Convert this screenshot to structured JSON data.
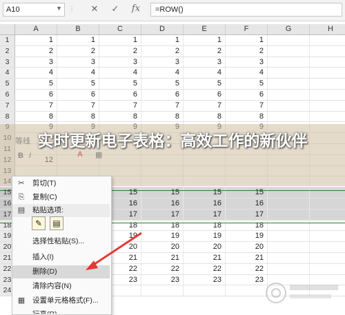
{
  "formula_bar": {
    "name_box": "A10",
    "cancel_icon": "✕",
    "confirm_icon": "✓",
    "fx_label": "fx",
    "formula": "=ROW()"
  },
  "columns": [
    "A",
    "B",
    "C",
    "D",
    "E",
    "F",
    "G",
    "H"
  ],
  "rows": [
    {
      "num": "1",
      "vals": [
        "1",
        "1",
        "1",
        "1",
        "1",
        "1"
      ]
    },
    {
      "num": "2",
      "vals": [
        "2",
        "2",
        "2",
        "2",
        "2",
        "2"
      ]
    },
    {
      "num": "3",
      "vals": [
        "3",
        "3",
        "3",
        "3",
        "3",
        "3"
      ]
    },
    {
      "num": "4",
      "vals": [
        "4",
        "4",
        "4",
        "4",
        "4",
        "4"
      ]
    },
    {
      "num": "5",
      "vals": [
        "5",
        "5",
        "5",
        "5",
        "5",
        "5"
      ]
    },
    {
      "num": "6",
      "vals": [
        "6",
        "6",
        "6",
        "6",
        "6",
        "6"
      ]
    },
    {
      "num": "7",
      "vals": [
        "7",
        "7",
        "7",
        "7",
        "7",
        "7"
      ]
    },
    {
      "num": "8",
      "vals": [
        "8",
        "8",
        "8",
        "8",
        "8",
        "8"
      ]
    },
    {
      "num": "9",
      "vals": [
        "9",
        "9",
        "9",
        "9",
        "9",
        "9"
      ]
    },
    {
      "num": "10",
      "vals": [
        "",
        "",
        "",
        "",
        "",
        ""
      ]
    },
    {
      "num": "11",
      "vals": [
        "",
        "",
        "",
        "",
        "",
        ""
      ]
    },
    {
      "num": "12",
      "vals": [
        "12",
        "",
        "",
        "",
        "",
        ""
      ]
    },
    {
      "num": "13",
      "vals": [
        "",
        "",
        "",
        "",
        "",
        ""
      ]
    },
    {
      "num": "14",
      "vals": [
        "",
        "",
        "",
        "",
        "",
        ""
      ]
    },
    {
      "num": "15",
      "vals": [
        "",
        "",
        "15",
        "15",
        "15",
        "15"
      ]
    },
    {
      "num": "16",
      "vals": [
        "",
        "",
        "16",
        "16",
        "16",
        "16"
      ]
    },
    {
      "num": "17",
      "vals": [
        "",
        "",
        "17",
        "17",
        "17",
        "17"
      ]
    },
    {
      "num": "18",
      "vals": [
        "",
        "",
        "18",
        "18",
        "18",
        "18"
      ]
    },
    {
      "num": "19",
      "vals": [
        "",
        "",
        "19",
        "19",
        "19",
        "19"
      ]
    },
    {
      "num": "20",
      "vals": [
        "",
        "",
        "20",
        "20",
        "20",
        "20"
      ]
    },
    {
      "num": "21",
      "vals": [
        "",
        "",
        "21",
        "21",
        "21",
        "21"
      ]
    },
    {
      "num": "22",
      "vals": [
        "",
        "",
        "22",
        "22",
        "22",
        "22"
      ]
    },
    {
      "num": "23",
      "vals": [
        "",
        "",
        "23",
        "23",
        "23",
        "23"
      ]
    },
    {
      "num": "24",
      "vals": [
        "",
        "",
        "",
        "",
        "",
        ""
      ]
    }
  ],
  "selected_rows": [
    "15",
    "16",
    "17"
  ],
  "title": "实时更新电子表格：高效工作的新伙伴",
  "mini_toolbar": {
    "font": "等线",
    "bold": "B",
    "italic": "I"
  },
  "context_menu": {
    "items": [
      {
        "label": "剪切(T)",
        "icon": "scissors-icon",
        "glyph": "✂"
      },
      {
        "label": "复制(C)",
        "icon": "copy-icon",
        "glyph": "⎘"
      },
      {
        "label": "粘贴选项:",
        "icon": "paste-icon",
        "glyph": "📋"
      },
      {
        "label": "选择性粘贴(S)...",
        "icon": "",
        "glyph": ""
      },
      {
        "label": "插入(I)",
        "icon": "",
        "glyph": ""
      },
      {
        "label": "删除(D)",
        "icon": "",
        "glyph": ""
      },
      {
        "label": "清除内容(N)",
        "icon": "",
        "glyph": ""
      },
      {
        "label": "设置单元格格式(F)...",
        "icon": "format-cells-icon",
        "glyph": "▦"
      },
      {
        "label": "行高(R)...",
        "icon": "",
        "glyph": ""
      }
    ]
  },
  "colors": {
    "selection_border": "#2e7d32",
    "arrow": "#e53935",
    "highlight": "#d9d9d9"
  },
  "watermark": {
    "text": "www.xxx.com"
  }
}
